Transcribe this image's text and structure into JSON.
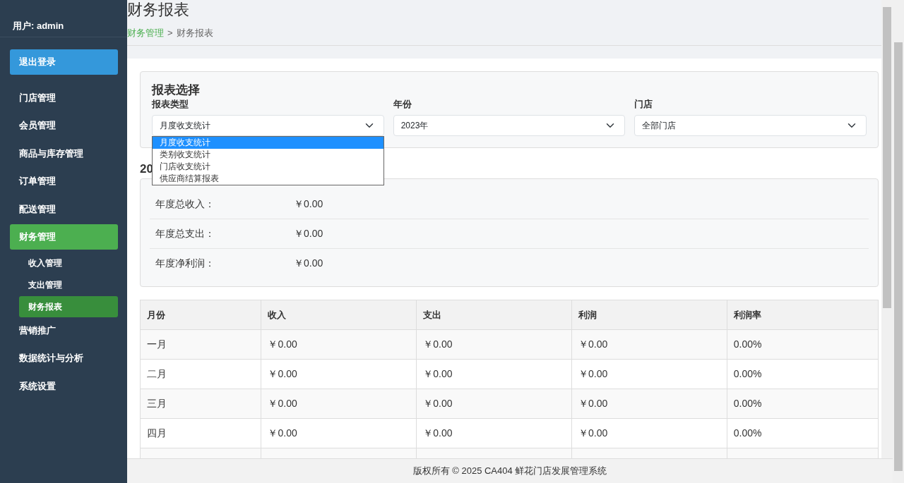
{
  "sidebar": {
    "user": "用户: admin",
    "items": [
      {
        "kind": "logout",
        "label": "退出登录"
      },
      {
        "kind": "nav",
        "label": "门店管理",
        "selected": false
      },
      {
        "kind": "nav",
        "label": "会员管理",
        "selected": false
      },
      {
        "kind": "nav",
        "label": "商品与库存管理",
        "selected": false
      },
      {
        "kind": "nav",
        "label": "订单管理",
        "selected": false
      },
      {
        "kind": "nav",
        "label": "配送管理",
        "selected": false
      },
      {
        "kind": "nav",
        "label": "财务管理",
        "selected": true,
        "children": [
          {
            "label": "收入管理",
            "selected": false
          },
          {
            "label": "支出管理",
            "selected": false
          },
          {
            "label": "财务报表",
            "selected": true
          }
        ]
      },
      {
        "kind": "nav",
        "label": "营销推广",
        "selected": false
      },
      {
        "kind": "nav",
        "label": "数据统计与分析",
        "selected": false
      },
      {
        "kind": "nav",
        "label": "系统设置",
        "selected": false
      }
    ]
  },
  "header": {
    "title": "财务报表",
    "breadcrumb": [
      {
        "label": "财务管理",
        "link": true
      },
      {
        "label": ">",
        "link": false
      },
      {
        "label": "财务报表",
        "link": false
      }
    ]
  },
  "report_select": {
    "title": "报表选择",
    "filters": [
      {
        "label": "报表类型",
        "value": "月度收支统计",
        "open": true,
        "options": [
          {
            "label": "月度收支统计",
            "selected": true
          },
          {
            "label": "类别收支统计",
            "selected": false
          },
          {
            "label": "门店收支统计",
            "selected": false
          },
          {
            "label": "供应商结算报表",
            "selected": false
          }
        ]
      },
      {
        "label": "年份",
        "value": "2023年",
        "open": false
      },
      {
        "label": "门店",
        "value": "全部门店",
        "open": false
      }
    ]
  },
  "summary": {
    "heading": "20",
    "rows": [
      {
        "label": "年度总收入：",
        "value": "￥0.00"
      },
      {
        "label": "年度总支出：",
        "value": "￥0.00"
      },
      {
        "label": "年度净利润：",
        "value": "￥0.00"
      }
    ]
  },
  "table": {
    "columns": [
      "月份",
      "收入",
      "支出",
      "利润",
      "利润率"
    ],
    "rows": [
      [
        "一月",
        "￥0.00",
        "￥0.00",
        "￥0.00",
        "0.00%"
      ],
      [
        "二月",
        "￥0.00",
        "￥0.00",
        "￥0.00",
        "0.00%"
      ],
      [
        "三月",
        "￥0.00",
        "￥0.00",
        "￥0.00",
        "0.00%"
      ],
      [
        "四月",
        "￥0.00",
        "￥0.00",
        "￥0.00",
        "0.00%"
      ]
    ]
  },
  "footer": "版权所有 © 2025 CA404 鲜花门店发展管理系统"
}
